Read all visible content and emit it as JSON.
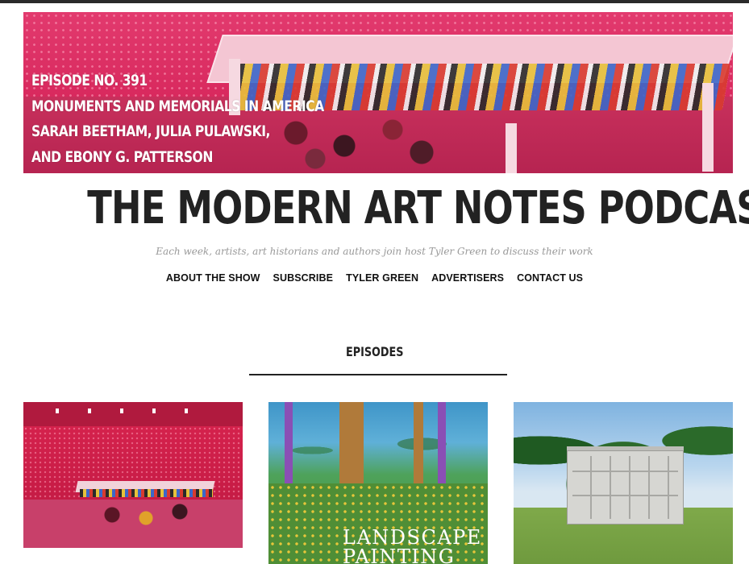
{
  "hero": {
    "lines": [
      "EPISODE NO. 391",
      "MONUMENTS AND MEMORIALS IN AMERICA",
      "SARAH BEETHAM, JULIA PULAWSKI,",
      "AND EBONY G. PATTERSON"
    ]
  },
  "site": {
    "title": "THE MODERN ART NOTES PODCAST",
    "tagline": "Each week, artists, art historians and authors join host Tyler Green to discuss their work"
  },
  "nav": {
    "items": [
      "ABOUT THE SHOW",
      "SUBSCRIBE",
      "TYLER GREEN",
      "ADVERTISERS",
      "CONTACT US"
    ]
  },
  "episodes": {
    "heading": "EPISODES",
    "cards": [
      {
        "image": "pink-gallery-installation"
      },
      {
        "image": "landscape-painting-book-cover",
        "title_lines": [
          "LANDSCAPE",
          "PAINTING"
        ]
      },
      {
        "image": "white-shed-sculpture-on-lawn"
      }
    ]
  },
  "colors": {
    "accent_pink": "#d8285d",
    "text_dark": "#222222",
    "tagline_gray": "#999999"
  }
}
